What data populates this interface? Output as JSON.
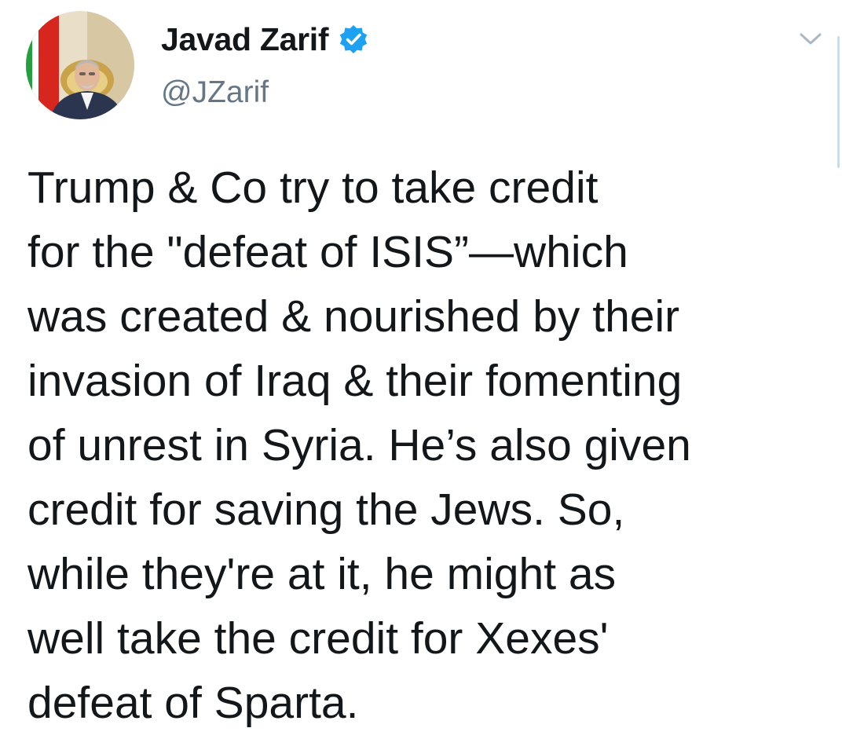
{
  "tweet": {
    "author": {
      "display_name": "Javad Zarif",
      "handle": "@JZarif",
      "verified": true,
      "avatar_icon": "profile-photo"
    },
    "text_lines": [
      "Trump & Co try to take credit",
      "for the \"defeat of ISIS”—which",
      "was created & nourished by their",
      "invasion of Iraq & their fomenting",
      "of unrest in Syria. He’s also given",
      "credit for saving the Jews. So,",
      "while they're at it, he might as",
      "well take the credit for Xexes'",
      "defeat of Sparta."
    ],
    "menu_icon": "chevron-down-icon"
  },
  "colors": {
    "text": "#14171a",
    "secondary_text": "#657786",
    "verified_badge": "#1da1f2",
    "chevron": "#aab8c2",
    "background": "#ffffff"
  }
}
